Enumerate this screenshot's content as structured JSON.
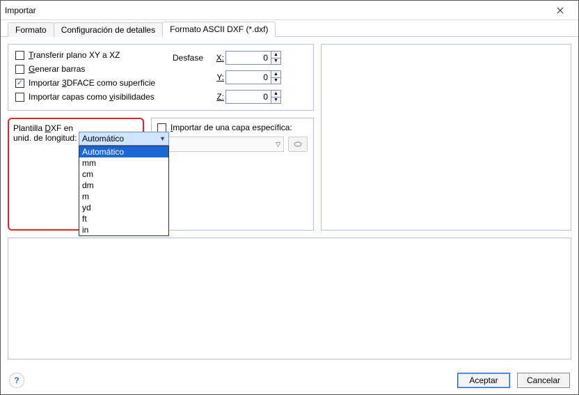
{
  "window": {
    "title": "Importar"
  },
  "tabs": [
    {
      "label": "Formato",
      "active": false
    },
    {
      "label": "Configuración de detalles",
      "active": false
    },
    {
      "label": "Formato ASCII DXF (*.dxf)",
      "active": true
    }
  ],
  "options": {
    "transfer": {
      "label": "Transferir plano XY a XZ",
      "checked": false
    },
    "generate": {
      "label": "Generar barras",
      "checked": false
    },
    "import3dface": {
      "label": "Importar 3DFACE como superficie",
      "checked": true
    },
    "importLayers": {
      "label": "Importar capas como visibilidades",
      "checked": false
    }
  },
  "offset": {
    "label": "Desfase",
    "x": {
      "label": "X:",
      "value": "0"
    },
    "y": {
      "label": "Y:",
      "value": "0"
    },
    "z": {
      "label": "Z:",
      "value": "0"
    }
  },
  "units": {
    "label1": "Plantilla DXF en",
    "label2": "unid. de longitud:",
    "selected": "Automático",
    "items": [
      "Automático",
      "mm",
      "cm",
      "dm",
      "m",
      "yd",
      "ft",
      "in"
    ]
  },
  "layer": {
    "checkLabel": "Importar de una capa específica:",
    "checked": false,
    "selected": ""
  },
  "buttons": {
    "ok": "Aceptar",
    "cancel": "Cancelar",
    "help": "?"
  }
}
